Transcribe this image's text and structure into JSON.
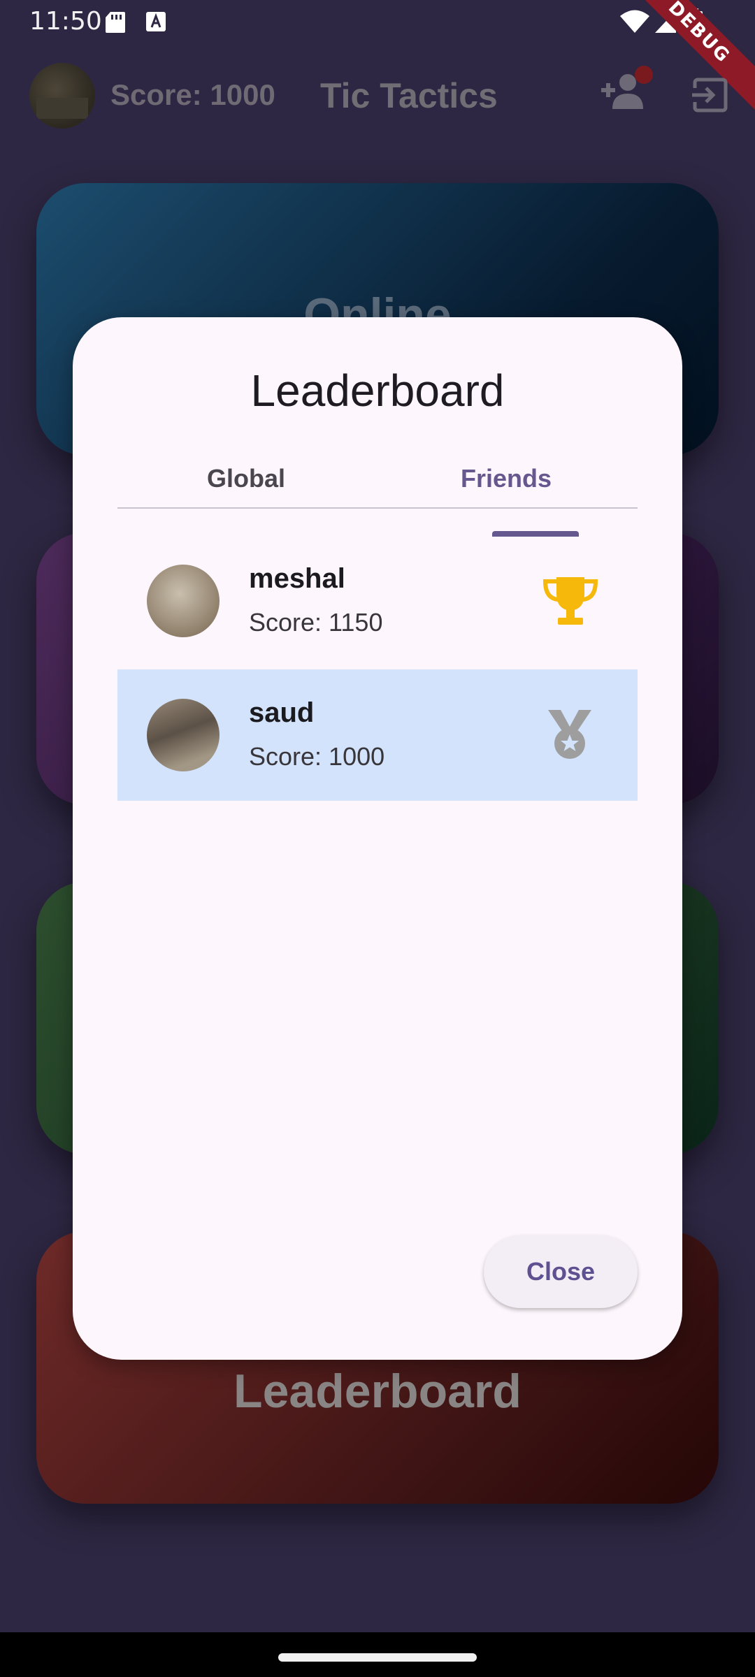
{
  "status_bar": {
    "time": "11:50",
    "debug_label": "DEBUG"
  },
  "app_bar": {
    "score_label": "Score: 1000",
    "title": "Tic Tactics"
  },
  "background_cards": {
    "online_label": "Online",
    "leaderboard_label": "Leaderboard"
  },
  "dialog": {
    "title": "Leaderboard",
    "tabs": [
      {
        "label": "Global",
        "selected": false
      },
      {
        "label": "Friends",
        "selected": true
      }
    ],
    "entries": [
      {
        "name": "meshal",
        "score": "Score: 1150",
        "badge": "trophy-icon",
        "badge_color": "#f6b80a",
        "highlighted": false
      },
      {
        "name": "saud",
        "score": "Score: 1000",
        "badge": "medal-icon",
        "badge_color": "#9e9e9e",
        "highlighted": true
      }
    ],
    "close_label": "Close"
  },
  "colors": {
    "accent": "#65588f",
    "highlight_row": "#d2e3fb",
    "dialog_bg": "#fdf6fc"
  }
}
